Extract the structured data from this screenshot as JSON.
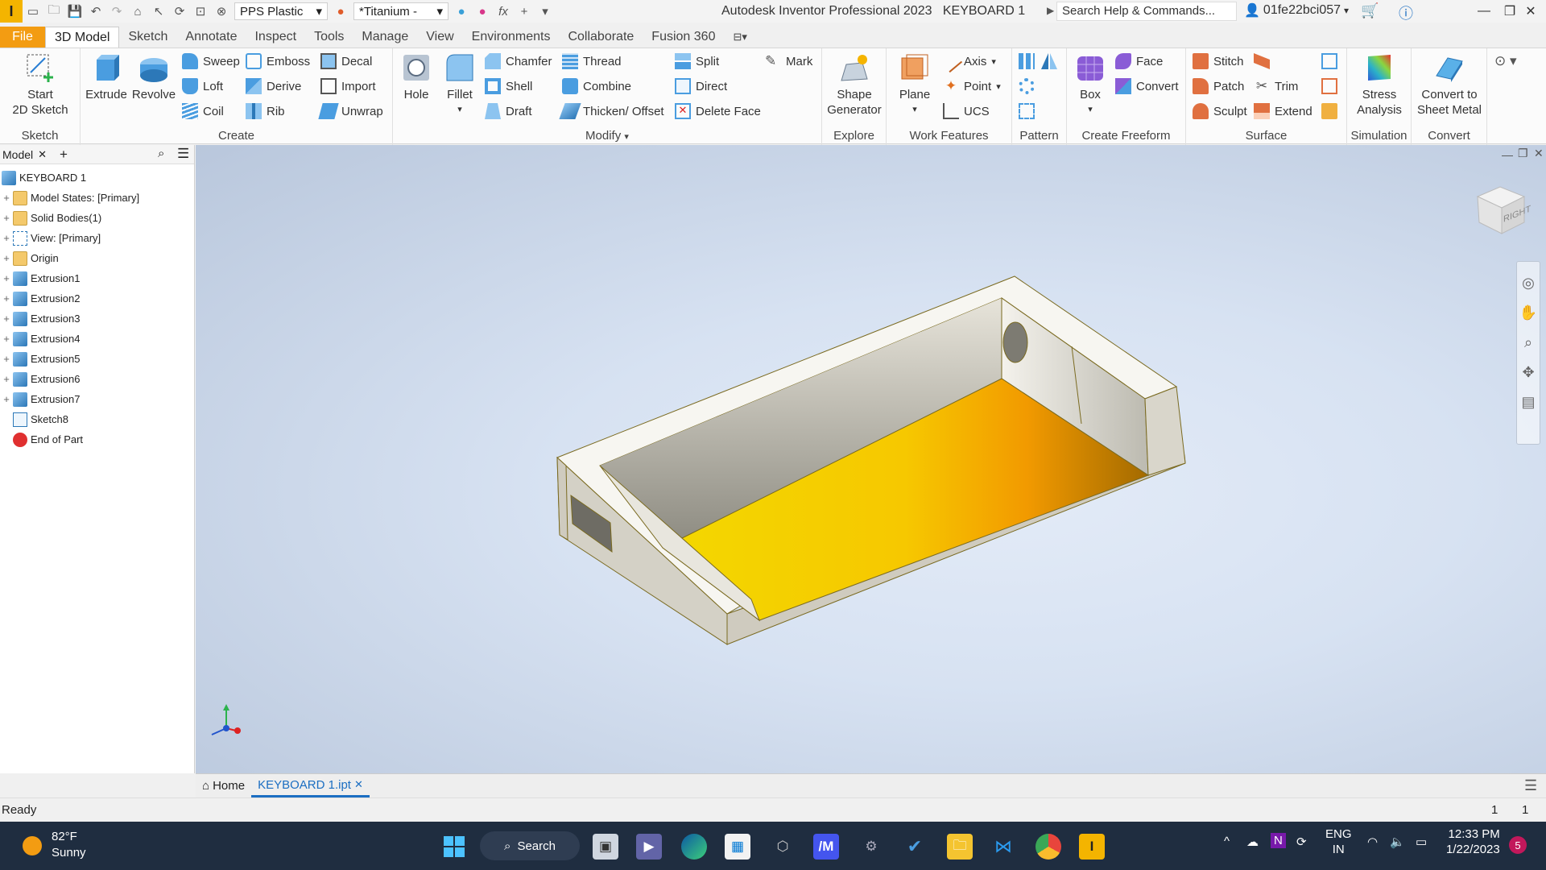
{
  "titlebar": {
    "app_logo": "I",
    "material": "PPS Plastic",
    "appearance": "*Titanium -",
    "fx_label": "fx",
    "app_title": "Autodesk Inventor Professional 2023",
    "doc_title": "KEYBOARD 1",
    "search_placeholder": "Search Help & Commands...",
    "username": "01fe22bci057"
  },
  "tabs": [
    "File",
    "3D Model",
    "Sketch",
    "Annotate",
    "Inspect",
    "Tools",
    "Manage",
    "View",
    "Environments",
    "Collaborate",
    "Fusion 360"
  ],
  "active_tab": "3D Model",
  "ribbon": {
    "sketch": {
      "label": "Sketch",
      "start_l1": "Start",
      "start_l2": "2D Sketch"
    },
    "create": {
      "label": "Create",
      "extrude": "Extrude",
      "revolve": "Revolve",
      "sweep": "Sweep",
      "loft": "Loft",
      "coil": "Coil",
      "emboss": "Emboss",
      "derive": "Derive",
      "rib": "Rib",
      "decal": "Decal",
      "import": "Import",
      "unwrap": "Unwrap"
    },
    "modify": {
      "label": "Modify",
      "hole": "Hole",
      "fillet": "Fillet",
      "chamfer": "Chamfer",
      "shell": "Shell",
      "draft": "Draft",
      "thread": "Thread",
      "combine": "Combine",
      "thicken": "Thicken/ Offset",
      "split": "Split",
      "direct": "Direct",
      "delete_face": "Delete Face",
      "mark": "Mark"
    },
    "explore": {
      "label": "Explore",
      "shape_l1": "Shape",
      "shape_l2": "Generator"
    },
    "work": {
      "label": "Work Features",
      "plane": "Plane",
      "axis": "Axis",
      "point": "Point",
      "ucs": "UCS"
    },
    "pattern": {
      "label": "Pattern"
    },
    "freeform": {
      "label": "Create Freeform",
      "box": "Box",
      "face": "Face",
      "convert": "Convert"
    },
    "surface": {
      "label": "Surface",
      "stitch": "Stitch",
      "patch": "Patch",
      "sculpt": "Sculpt",
      "trim": "Trim",
      "extend": "Extend"
    },
    "simulation": {
      "label": "Simulation",
      "stress_l1": "Stress",
      "stress_l2": "Analysis"
    },
    "convert": {
      "label": "Convert",
      "sheet_l1": "Convert to",
      "sheet_l2": "Sheet Metal"
    }
  },
  "browser": {
    "tab_label": "Model",
    "root": "KEYBOARD 1",
    "items": [
      {
        "label": "Model States: [Primary]",
        "icon": "folder-icon"
      },
      {
        "label": "Solid Bodies(1)",
        "icon": "folder-icon"
      },
      {
        "label": "View: [Primary]",
        "icon": "view-icon"
      },
      {
        "label": "Origin",
        "icon": "folder-icon"
      },
      {
        "label": "Extrusion1",
        "icon": "extrusion-icon"
      },
      {
        "label": "Extrusion2",
        "icon": "extrusion-icon"
      },
      {
        "label": "Extrusion3",
        "icon": "extrusion-icon"
      },
      {
        "label": "Extrusion4",
        "icon": "extrusion-icon"
      },
      {
        "label": "Extrusion5",
        "icon": "extrusion-icon"
      },
      {
        "label": "Extrusion6",
        "icon": "extrusion-icon"
      },
      {
        "label": "Extrusion7",
        "icon": "extrusion-icon"
      },
      {
        "label": "Sketch8",
        "icon": "sketch-icon"
      },
      {
        "label": "End of Part",
        "icon": "end-of-part-icon"
      }
    ]
  },
  "viewcube": {
    "face_label": "RIGHT"
  },
  "doctabs": {
    "home": "Home",
    "active_doc": "KEYBOARD 1.ipt"
  },
  "status": {
    "text": "Ready",
    "count1": "1",
    "count2": "1"
  },
  "taskbar": {
    "temp": "82°F",
    "weather": "Sunny",
    "search": "Search",
    "lang1": "ENG",
    "lang2": "IN",
    "time": "12:33 PM",
    "date": "1/22/2023",
    "notif_count": "5"
  },
  "colors": {
    "accent": "#f39c12",
    "face_yellow": "#f5c400",
    "face_orange": "#f19a00",
    "body_gray": "#e4e1d8"
  }
}
